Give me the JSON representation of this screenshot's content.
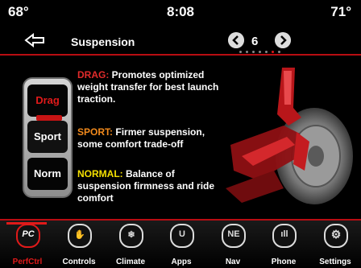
{
  "status": {
    "temp_left": "68°",
    "clock": "8:08",
    "temp_right": "71°"
  },
  "header": {
    "title": "Suspension",
    "page": "6",
    "page_dots": 7,
    "active_dot": 5
  },
  "selector": {
    "options": [
      "Drag",
      "Sport",
      "Norm"
    ],
    "selected": "Drag"
  },
  "descriptions": [
    {
      "keyword": "DRAG:",
      "text": "Promotes optimized weight transfer for best launch traction.",
      "color": "#e22b2b"
    },
    {
      "keyword": "SPORT:",
      "text": "Firmer suspension, some comfort trade-off",
      "color": "#f28a1c"
    },
    {
      "keyword": "NORMAL:",
      "text": "Balance of suspension firmness and ride comfort",
      "color": "#f4e000"
    }
  ],
  "nav": [
    {
      "label": "PerfCtrl",
      "icon": "perfctrl-icon",
      "glyph": "PC",
      "active": true
    },
    {
      "label": "Controls",
      "icon": "controls-icon",
      "glyph": "✋",
      "active": false
    },
    {
      "label": "Climate",
      "icon": "climate-icon",
      "glyph": "❄",
      "active": false
    },
    {
      "label": "Apps",
      "icon": "apps-icon",
      "glyph": "U",
      "active": false
    },
    {
      "label": "Nav",
      "icon": "nav-icon",
      "glyph": "NE",
      "active": false
    },
    {
      "label": "Phone",
      "icon": "phone-icon",
      "glyph": "ıll",
      "active": false
    },
    {
      "label": "Settings",
      "icon": "settings-icon",
      "glyph": "⚙",
      "active": false
    }
  ],
  "colors": {
    "accent": "#e01a1a",
    "background": "#000000"
  }
}
